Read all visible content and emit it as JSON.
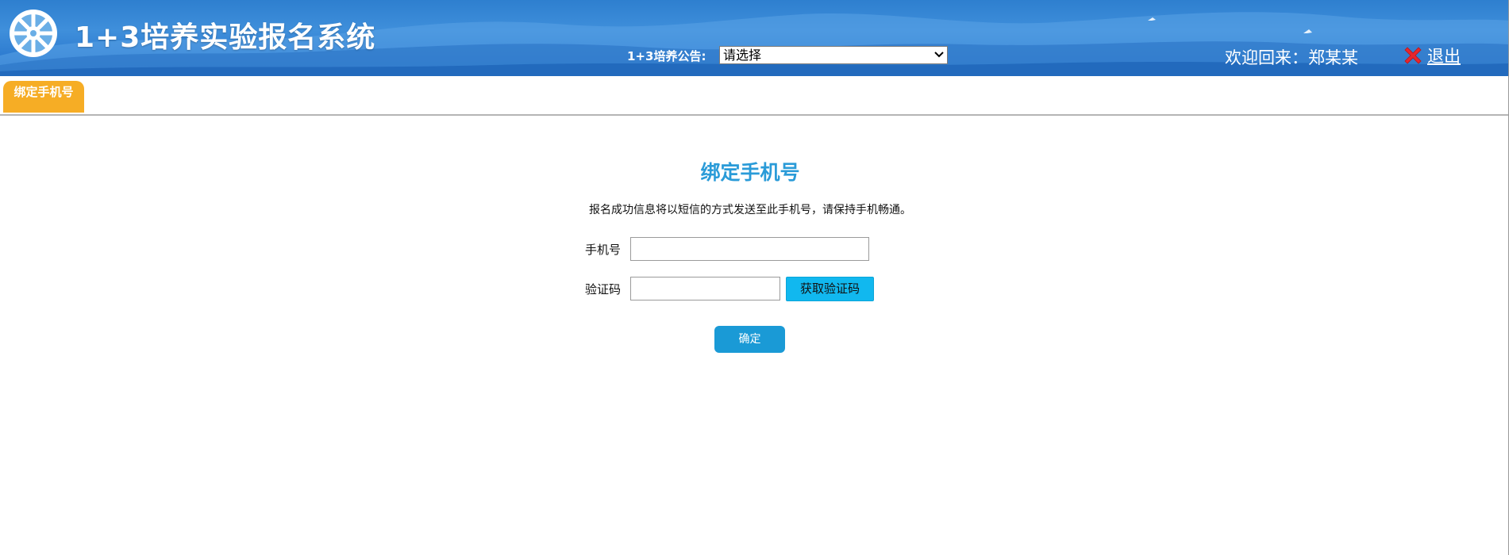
{
  "header": {
    "app_title": "1+3培养实验报名系统",
    "notice_label": "1+3培养公告:",
    "notice_select_value": "请选择",
    "welcome_text": "欢迎回来：郑某某",
    "logout_label": "退出"
  },
  "tabs": [
    {
      "label": "绑定手机号",
      "active": true
    }
  ],
  "form": {
    "title": "绑定手机号",
    "description": "报名成功信息将以短信的方式发送至此手机号，请保持手机畅通。",
    "phone_label": "手机号",
    "phone_value": "",
    "code_label": "验证码",
    "code_value": "",
    "get_code_button": "获取验证码",
    "confirm_button": "确定"
  },
  "colors": {
    "header_blue": "#2d7bd0",
    "tab_orange": "#f6ad25",
    "title_blue": "#2a9bd8",
    "code_button_cyan": "#11b8ef",
    "confirm_button_blue": "#1a9ad6",
    "logout_red": "#e8262c"
  },
  "icons": {
    "logo": "emblem-icon",
    "logout": "close-x-icon",
    "select": "chevron-down-icon"
  }
}
